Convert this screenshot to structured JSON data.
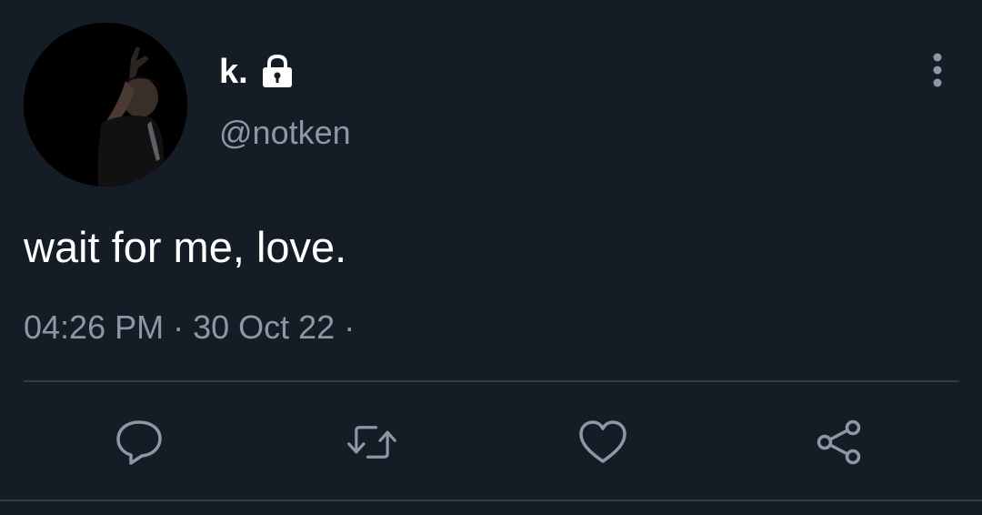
{
  "user": {
    "display_name": "k.",
    "handle": "@notken",
    "avatar_icon": "profile-photo",
    "verified_icon": "lock-icon"
  },
  "tweet": {
    "text": "wait for me, love.",
    "time": "04:26 PM",
    "separator": "·",
    "date": "30 Oct 22",
    "trailing_separator": "·"
  },
  "actions": {
    "reply_icon": "reply-icon",
    "retweet_icon": "retweet-icon",
    "like_icon": "heart-icon",
    "share_icon": "share-icon"
  },
  "colors": {
    "background": "#141c26",
    "primary_text": "#ffffff",
    "secondary_text": "#8b98a5",
    "divider": "#2f3b47"
  }
}
